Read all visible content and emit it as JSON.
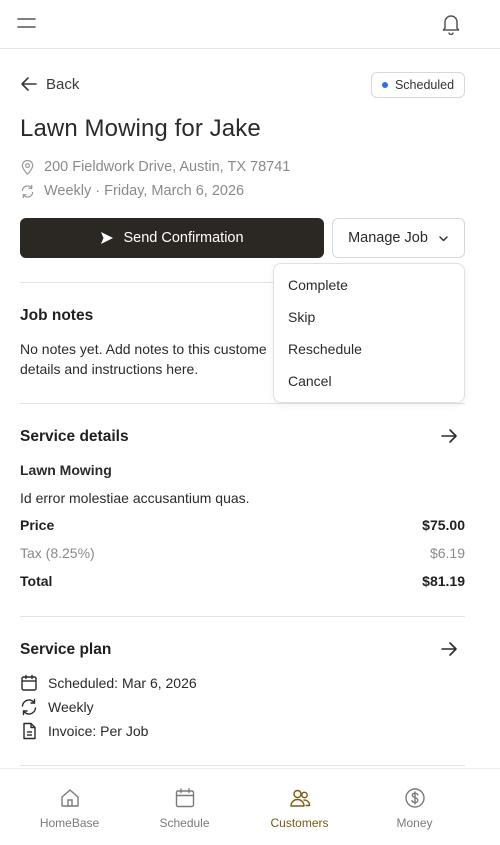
{
  "header": {
    "menu_icon": "hamburger-menu-icon",
    "notification_icon": "bell-icon"
  },
  "nav": {
    "back_label": "Back"
  },
  "status": {
    "label": "Scheduled",
    "dot_color": "#2f6fe4"
  },
  "job": {
    "title": "Lawn Mowing for Jake",
    "address": "200 Fieldwork Drive, Austin, TX 78741",
    "recurrence": "Weekly · Friday, March 6, 2026"
  },
  "actions": {
    "send_confirmation": "Send Confirmation",
    "manage_job": "Manage Job"
  },
  "manage_menu": {
    "items": [
      "Complete",
      "Skip",
      "Reschedule",
      "Cancel"
    ]
  },
  "job_notes": {
    "title": "Job notes",
    "line1": "No notes yet. Add notes to this custome",
    "line2": "details and instructions here."
  },
  "service_details": {
    "title": "Service details",
    "service_name": "Lawn Mowing",
    "description": "Id error molestiae accusantium quas.",
    "price_label": "Price",
    "price_value": "$75.00",
    "tax_label": "Tax (8.25%)",
    "tax_value": "$6.19",
    "total_label": "Total",
    "total_value": "$81.19"
  },
  "service_plan": {
    "title": "Service plan",
    "scheduled": "Scheduled: Mar 6, 2026",
    "frequency": "Weekly",
    "invoice": "Invoice: Per Job"
  },
  "bottom_nav": {
    "items": [
      {
        "label": "HomeBase",
        "icon": "home-icon"
      },
      {
        "label": "Schedule",
        "icon": "calendar-icon"
      },
      {
        "label": "Customers",
        "icon": "customers-icon",
        "active": true
      },
      {
        "label": "Money",
        "icon": "dollar-icon"
      }
    ],
    "active_color": "#7a5a10",
    "inactive_color": "#7a7a7a"
  },
  "colors": {
    "primary_button": "#2b2723",
    "accent": "#7a5a10"
  }
}
